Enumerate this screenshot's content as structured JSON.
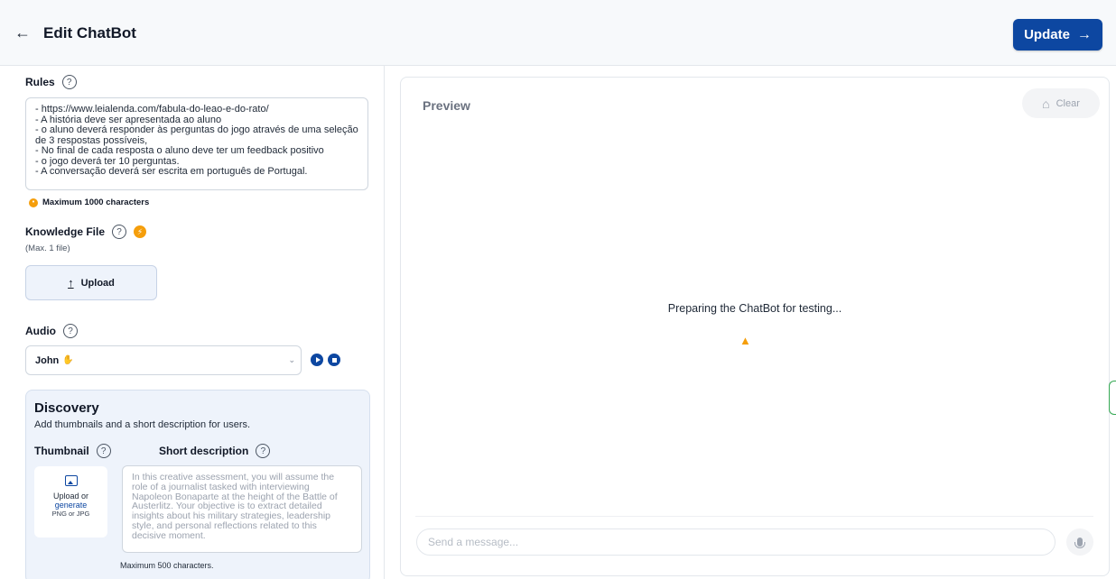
{
  "header": {
    "back_icon": "arrow-left-icon",
    "title": "Edit ChatBot",
    "update_label": "Update",
    "update_arrow": "→"
  },
  "rules": {
    "label": "Rules",
    "text": "- https://www.leialenda.com/fabula-do-leao-e-do-rato/\n- A história deve ser apresentada ao aluno\n- o aluno deverá responder às perguntas do jogo através de uma seleção de 3 respostas possíveis,\n- No final de cada resposta o aluno deve ter um feedback positivo\n- o jogo deverá ter 10 perguntas.\n- A conversação deverá ser escrita em português de Portugal.",
    "max_note": "Maximum 1000 characters"
  },
  "knowledge_file": {
    "label": "Knowledge File",
    "sub": "(Max. 1 file)",
    "upload_label": "Upload"
  },
  "audio": {
    "label": "Audio",
    "selected_voice": "John"
  },
  "discovery": {
    "title": "Discovery",
    "subtitle": "Add thumbnails and a short description for users.",
    "thumbnail_label": "Thumbnail",
    "short_description_label": "Short description",
    "upload_or": "Upload or",
    "generate": "generate",
    "formats": "PNG or JPG",
    "description_placeholder": "In this creative assessment, you will assume the role of a journalist tasked with interviewing Napoleon Bonaparte at the height of the Battle of Austerlitz. Your objective is to extract detailed insights about his military strategies, leadership style, and personal reflections related to this decisive moment.",
    "max_note": "Maximum 500 characters."
  },
  "preview": {
    "title": "Preview",
    "clear_label": "Clear",
    "status": "Preparing the ChatBot for testing...",
    "message_placeholder": "Send a message..."
  },
  "colors": {
    "accent": "#0d47a1",
    "warning": "#f59e0b",
    "border": "#e3e7ec"
  }
}
